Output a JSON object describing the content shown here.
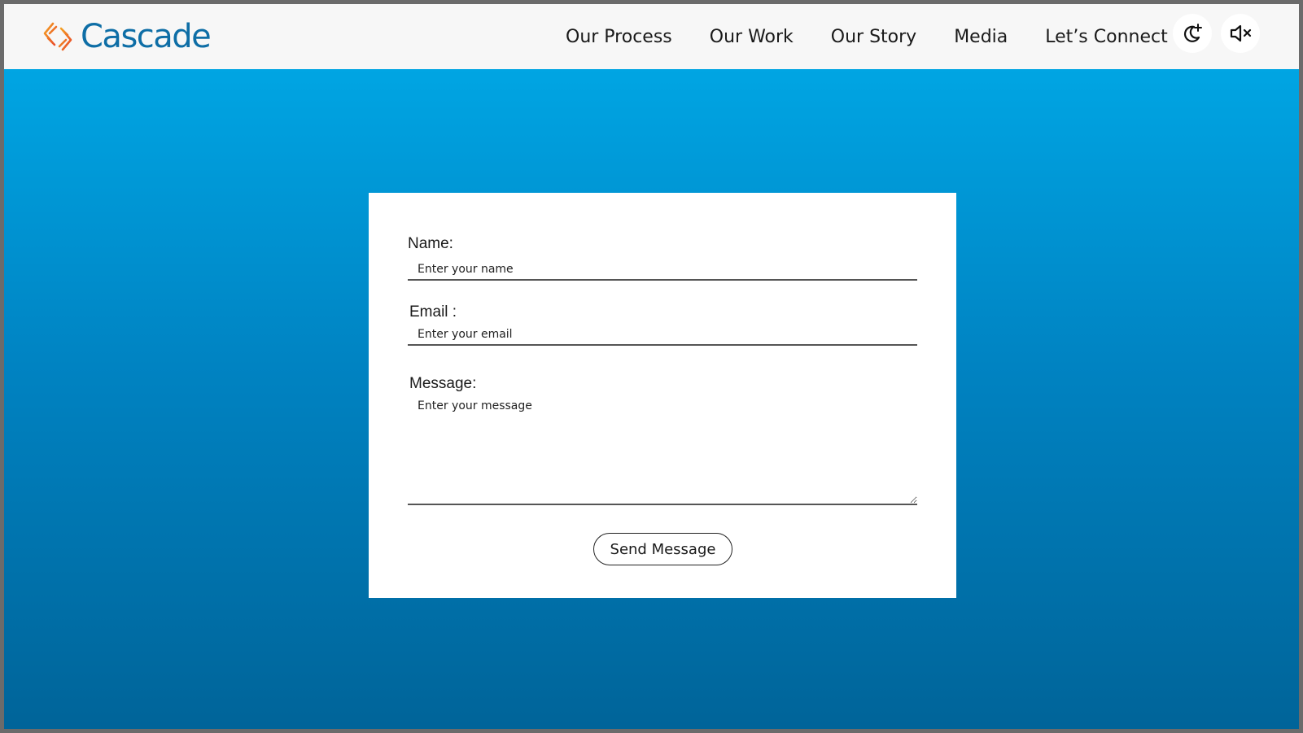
{
  "brand": {
    "name": "Cascade",
    "color": "#0e6ea6",
    "mark_colors": [
      "#f5a623",
      "#e8462a"
    ]
  },
  "nav": {
    "items": [
      {
        "label": "Our Process"
      },
      {
        "label": "Our Work"
      },
      {
        "label": "Our Story"
      },
      {
        "label": "Media"
      },
      {
        "label": "Let’s Connect"
      }
    ]
  },
  "header_icons": {
    "theme": "moon-sparkle-icon",
    "sound": "speaker-muted-icon"
  },
  "form": {
    "name_label": "Name:",
    "name_placeholder": "Enter your name",
    "email_label": "Email :",
    "email_placeholder": "Enter your email",
    "message_label": "Message:",
    "message_placeholder": "Enter your message",
    "submit_label": "Send Message"
  },
  "colors": {
    "background_top": "#00a5e3",
    "background_bottom": "#006499",
    "card": "#ffffff"
  }
}
